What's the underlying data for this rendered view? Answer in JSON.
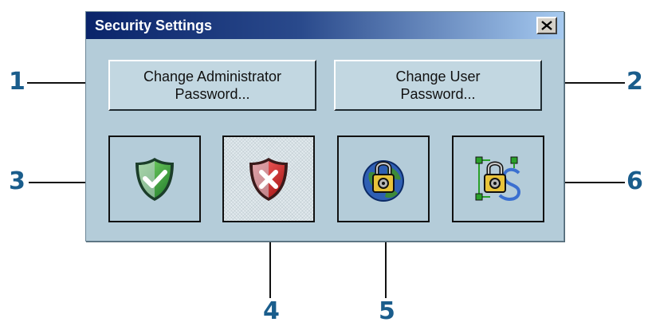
{
  "window": {
    "title": "Security Settings",
    "close_label": "X"
  },
  "buttons": {
    "change_admin_password": "Change Administrator\nPassword...",
    "change_user_password": "Change User\nPassword..."
  },
  "icon_buttons": [
    {
      "icon": "green-shield-check-icon",
      "pressed": false
    },
    {
      "icon": "red-shield-x-icon",
      "pressed": true
    },
    {
      "icon": "globe-padlock-icon",
      "pressed": false
    },
    {
      "icon": "protocol-padlock-icon",
      "pressed": false
    }
  ],
  "callouts": [
    "1",
    "2",
    "3",
    "4",
    "5",
    "6"
  ],
  "colors": {
    "dialog_bg": "#b4ccd9",
    "title_gradient_start": "#0a246a",
    "title_gradient_end": "#a6caf0",
    "callout": "#1a5d8c"
  }
}
